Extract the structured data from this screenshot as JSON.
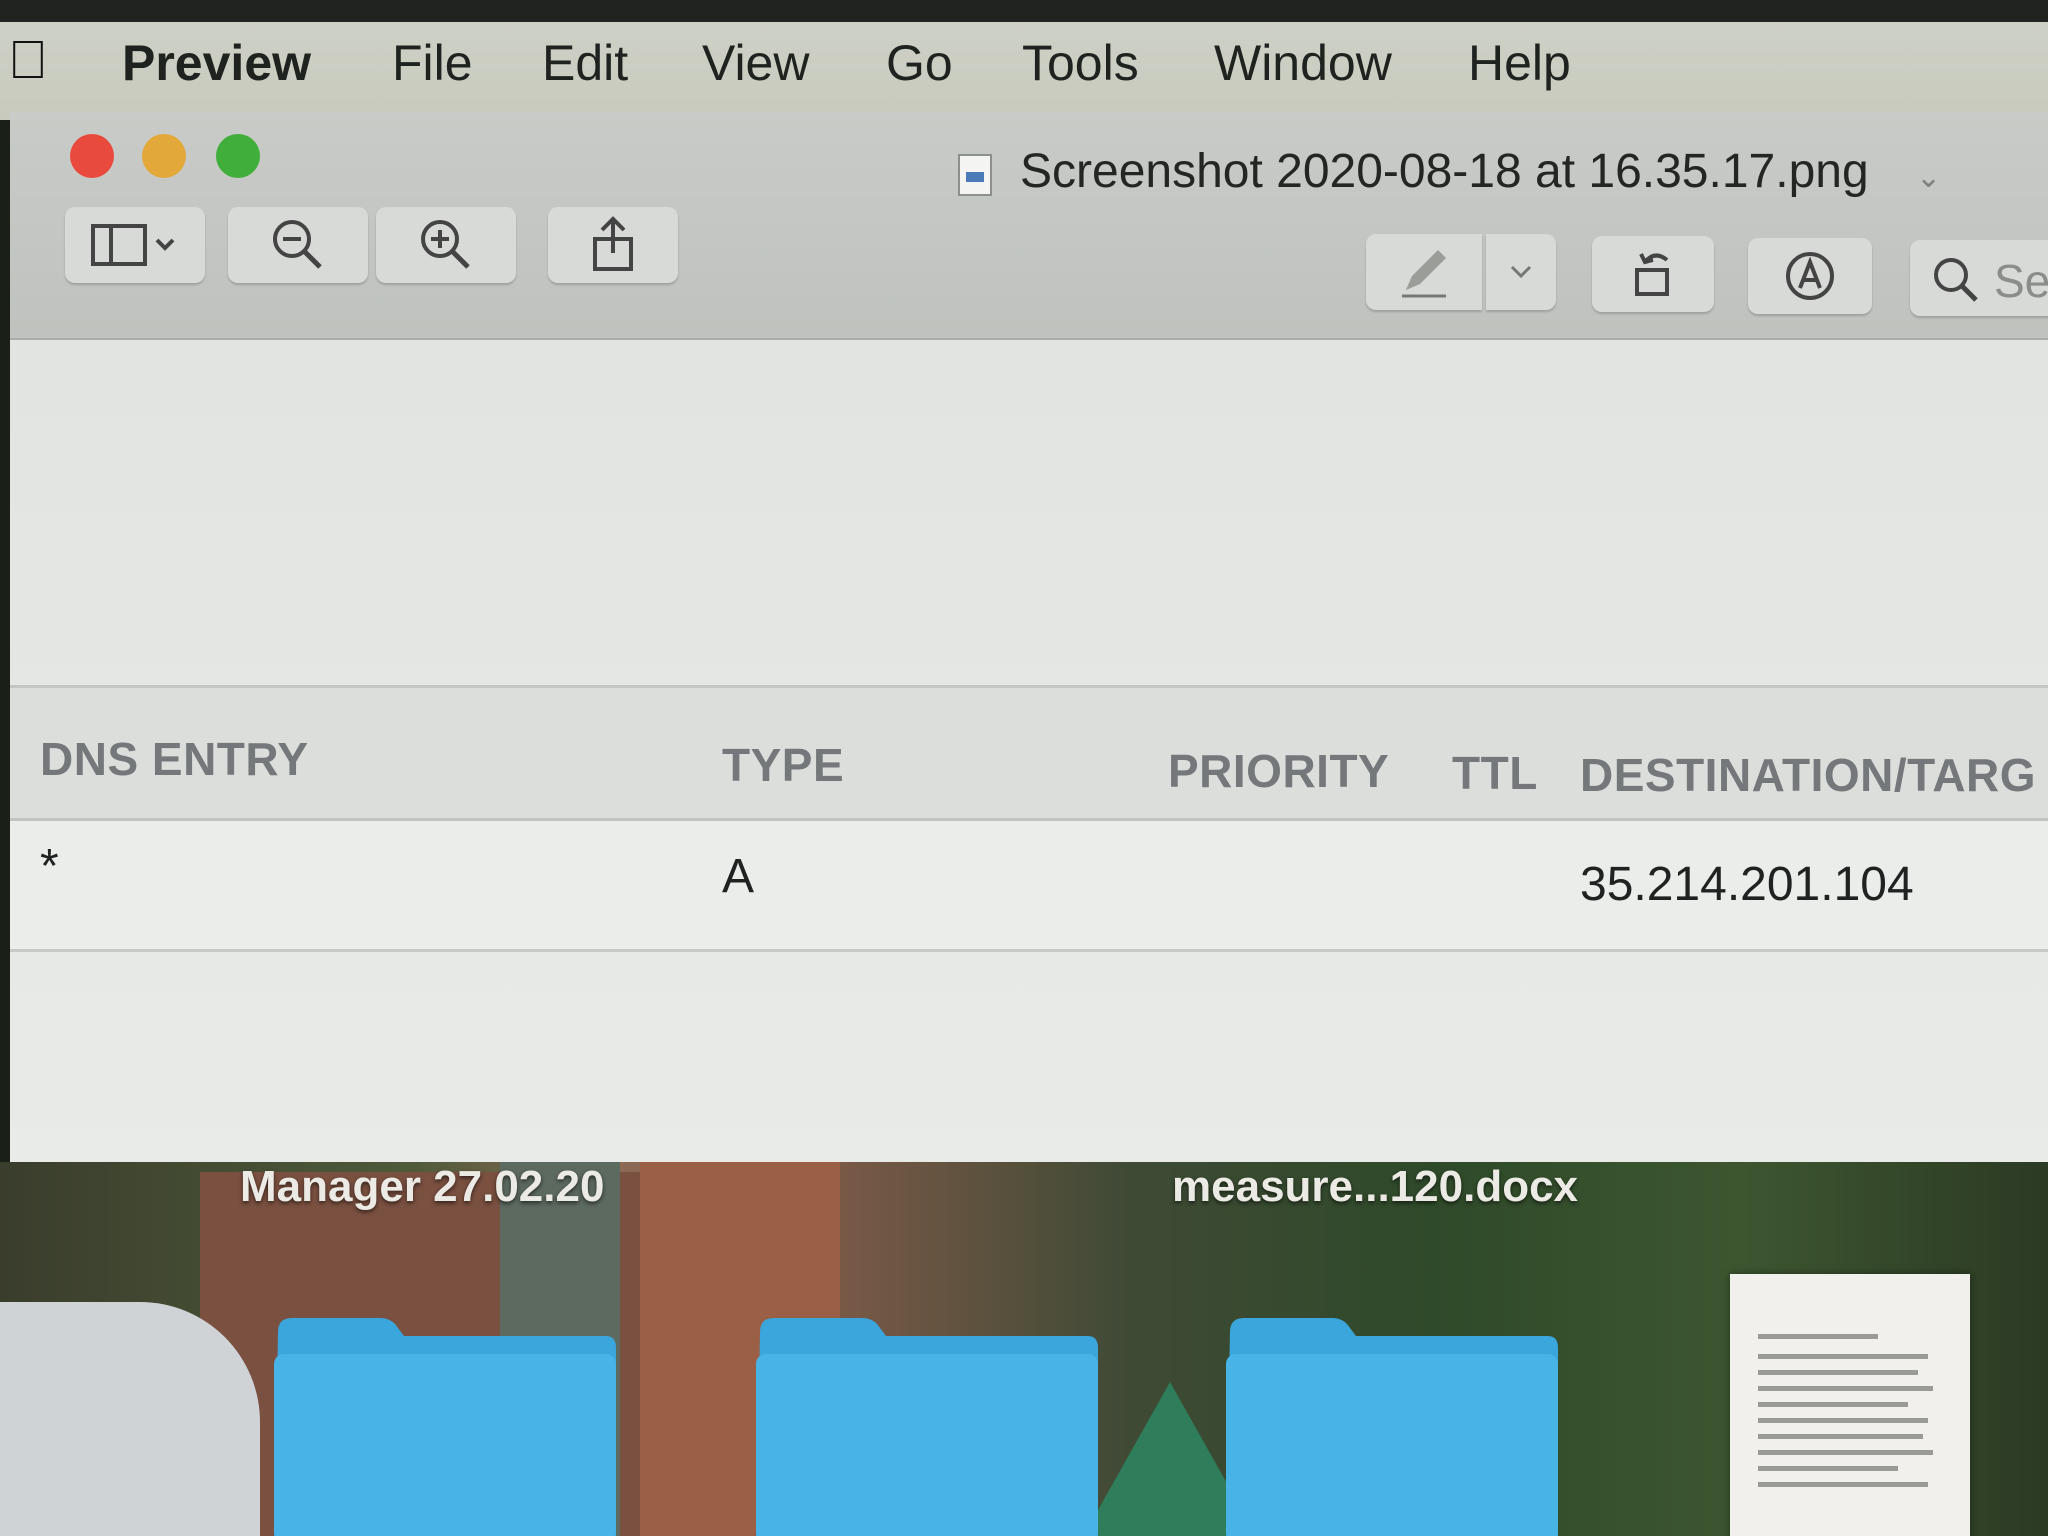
{
  "menubar": {
    "app_name": "Preview",
    "items": [
      "File",
      "Edit",
      "View",
      "Go",
      "Tools",
      "Window",
      "Help"
    ]
  },
  "window": {
    "title": "Screenshot 2020-08-18 at 16.35.17.png",
    "search_placeholder": "Sea"
  },
  "table": {
    "columns": [
      "DNS ENTRY",
      "TYPE",
      "PRIORITY",
      "TTL",
      "DESTINATION/TARG"
    ],
    "rows": [
      {
        "dns_entry": "*",
        "type": "A",
        "priority": "",
        "ttl": "",
        "destination": "35.214.201.104"
      }
    ]
  },
  "desktop": {
    "labels": [
      "Manager 27.02.20",
      "measure...120.docx"
    ]
  }
}
